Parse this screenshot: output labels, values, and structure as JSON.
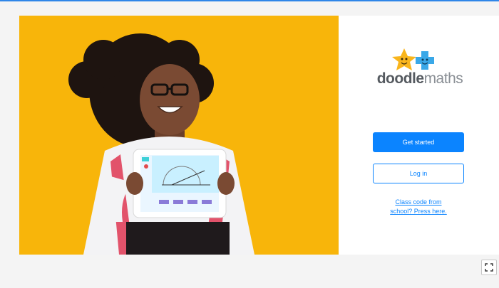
{
  "brand": {
    "part1": "doodle",
    "part2": "maths"
  },
  "actions": {
    "get_started": "Get started",
    "log_in": "Log in",
    "class_code_line1": "Class code from",
    "class_code_line2": "school? Press here."
  },
  "icons": {
    "fullscreen": "fullscreen-icon",
    "logo_star": "star-icon",
    "logo_cross": "plus-icon"
  },
  "colors": {
    "accent": "#0b84ff",
    "hero_bg": "#f8b50a",
    "star": "#f9b51c",
    "cross": "#3aa8e8"
  }
}
